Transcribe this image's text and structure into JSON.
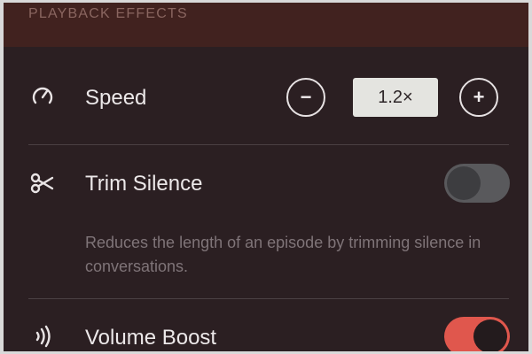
{
  "section": {
    "title": "PLAYBACK EFFECTS"
  },
  "speed": {
    "icon": "speedometer-icon",
    "label": "Speed",
    "value": "1.2×",
    "decrease_symbol": "−",
    "increase_symbol": "+"
  },
  "trim_silence": {
    "icon": "scissors-icon",
    "label": "Trim Silence",
    "enabled": false,
    "description": "Reduces the length of an episode by trimming silence in conversations."
  },
  "volume_boost": {
    "icon": "sound-waves-icon",
    "label": "Volume Boost",
    "enabled": true
  },
  "colors": {
    "background": "#2b1f22",
    "header_background": "#41221f",
    "accent_on": "#e0574d",
    "toggle_off": "#59595c"
  }
}
